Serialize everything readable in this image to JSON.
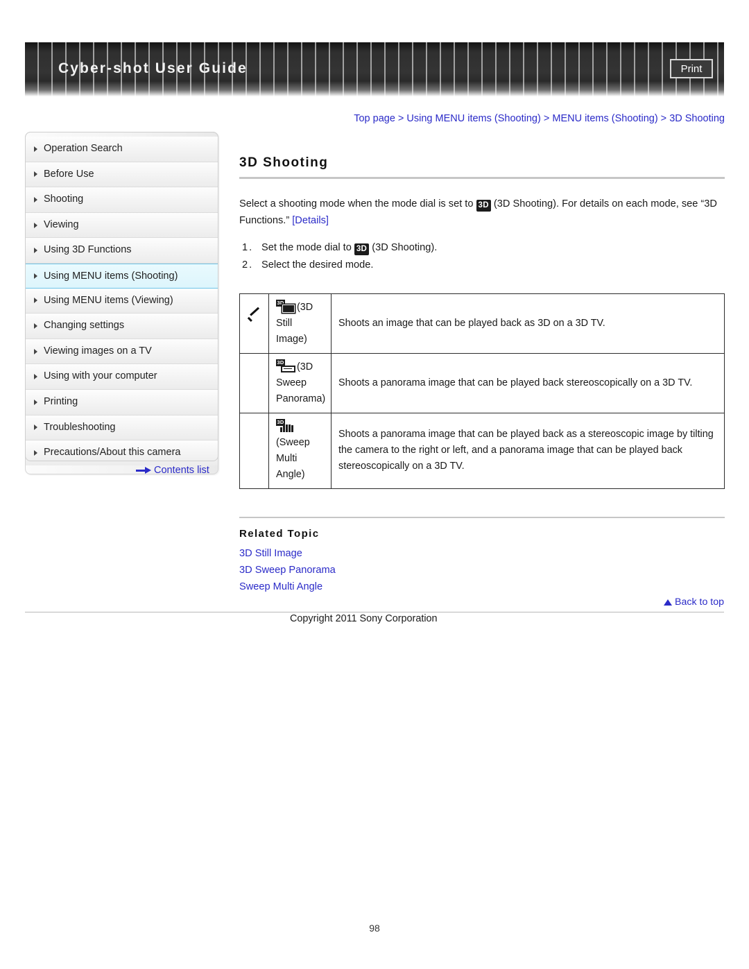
{
  "header": {
    "title": "Cyber-shot User Guide",
    "print_label": "Print"
  },
  "breadcrumb": {
    "separator": " > ",
    "items": [
      "Top page",
      "Using MENU items (Shooting)",
      "MENU items (Shooting)",
      "3D Shooting"
    ]
  },
  "sidebar": {
    "items": [
      {
        "label": "Operation Search",
        "active": false
      },
      {
        "label": "Before Use",
        "active": false
      },
      {
        "label": "Shooting",
        "active": false
      },
      {
        "label": "Viewing",
        "active": false
      },
      {
        "label": "Using 3D Functions",
        "active": false
      },
      {
        "label": "Using MENU items (Shooting)",
        "active": true
      },
      {
        "label": "Using MENU items (Viewing)",
        "active": false
      },
      {
        "label": "Changing settings",
        "active": false
      },
      {
        "label": "Viewing images on a TV",
        "active": false
      },
      {
        "label": "Using with your computer",
        "active": false
      },
      {
        "label": "Printing",
        "active": false
      },
      {
        "label": "Troubleshooting",
        "active": false
      },
      {
        "label": "Precautions/About this camera",
        "active": false
      }
    ],
    "contents_list_label": "Contents list"
  },
  "main": {
    "page_title": "3D Shooting",
    "intro_part1": "Select a shooting mode when the mode dial is set to ",
    "intro_badge": "3D",
    "intro_part2": " (3D Shooting). For details on each mode, see “3D Functions.” ",
    "intro_details_link": "[Details]",
    "steps": [
      {
        "num": "1.",
        "text_before": "Set the mode dial to ",
        "badge": "3D",
        "text_after": " (3D Shooting)."
      },
      {
        "num": "2.",
        "text_before": "Select the desired mode.",
        "badge": "",
        "text_after": ""
      }
    ],
    "table": {
      "rows": [
        {
          "checked": true,
          "icon": "3d-still-image-icon",
          "icon_tag": "3D",
          "mode_label": "(3D Still Image)",
          "description": "Shoots an image that can be played back as 3D on a 3D TV."
        },
        {
          "checked": false,
          "icon": "3d-sweep-panorama-icon",
          "icon_tag": "3D",
          "mode_label": "(3D Sweep Panorama)",
          "description": "Shoots a panorama image that can be played back stereoscopically on a 3D TV."
        },
        {
          "checked": false,
          "icon": "sweep-multi-angle-icon",
          "icon_tag": "3D",
          "mode_label": "(Sweep Multi Angle)",
          "description": "Shoots a panorama image that can be played back as a stereoscopic image by tilting the camera to the right or left, and a panorama image that can be played back stereoscopically on a 3D TV."
        }
      ]
    },
    "related": {
      "title": "Related Topic",
      "links": [
        "3D Still Image",
        "3D Sweep Panorama",
        "Sweep Multi Angle"
      ]
    }
  },
  "footer": {
    "back_to_top": "Back to top",
    "copyright": "Copyright 2011 Sony Corporation",
    "page_number": "98"
  },
  "colors": {
    "link": "#2b2bc8",
    "banner_dark": "#2f2f2f",
    "active_nav_bg": "#ddf5fc",
    "active_nav_border": "#6fc5e8",
    "rule": "#c6c6c6"
  }
}
